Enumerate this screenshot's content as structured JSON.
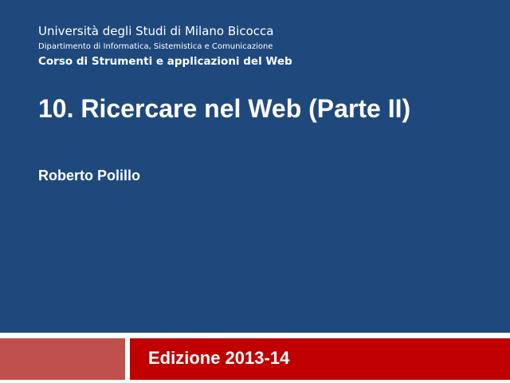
{
  "header": {
    "university": "Università degli Studi di Milano Bicocca",
    "department": "Dipartimento di Informatica, Sistemistica e Comunicazione",
    "course": "Corso di Strumenti e applicazioni del Web"
  },
  "slide": {
    "title": "10. Ricercare nel Web (Parte II)",
    "author": "Roberto Polillo",
    "edition": "Edizione 2013-14"
  },
  "colors": {
    "top_panel": "#1f497d",
    "bottom_left_bar": "#c0504d",
    "bottom_right_bar": "#c00000",
    "text": "#ffffff"
  }
}
